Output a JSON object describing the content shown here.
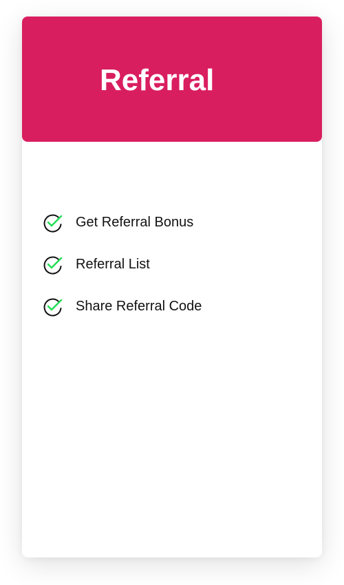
{
  "card": {
    "title": "Referral",
    "header_color": "#d91e5f",
    "features": [
      {
        "label": "Get Referral Bonus",
        "icon": "check-circle-icon"
      },
      {
        "label": "Referral List",
        "icon": "check-circle-icon"
      },
      {
        "label": "Share Referral Code",
        "icon": "check-circle-icon"
      }
    ],
    "check_color": "#22dd55"
  }
}
